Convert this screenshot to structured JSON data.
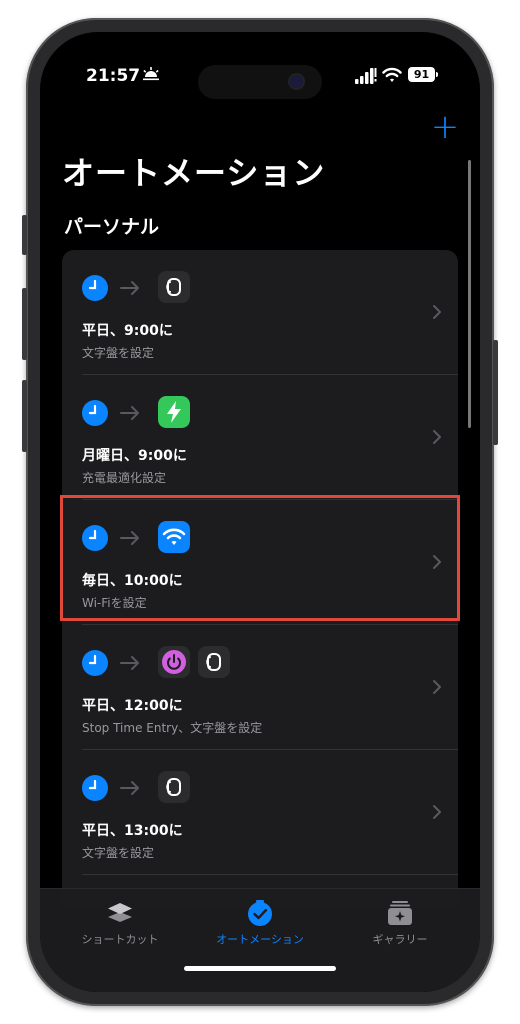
{
  "status_bar": {
    "time": "21:57",
    "battery": "91"
  },
  "header": {
    "title": "オートメーション",
    "add_label": "+"
  },
  "section": {
    "title": "パーソナル"
  },
  "automations": [
    {
      "title": "平日、9:00に",
      "subtitle": "文字盤を設定",
      "actions": [
        "watch-face-icon"
      ]
    },
    {
      "title": "月曜日、9:00に",
      "subtitle": "充電最適化設定",
      "actions": [
        "bolt-icon"
      ]
    },
    {
      "title": "毎日、10:00に",
      "subtitle": "Wi-Fiを設定",
      "actions": [
        "wifi-icon"
      ],
      "highlighted": true
    },
    {
      "title": "平日、12:00に",
      "subtitle": "Stop Time Entry、文字盤を設定",
      "actions": [
        "power-icon",
        "watch-face-icon"
      ]
    },
    {
      "title": "平日、13:00に",
      "subtitle": "文字盤を設定",
      "actions": [
        "watch-face-icon"
      ]
    }
  ],
  "tab_bar": {
    "tabs": [
      {
        "label": "ショートカット",
        "icon": "layers-icon",
        "active": false
      },
      {
        "label": "オートメーション",
        "icon": "clock-check-icon",
        "active": true
      },
      {
        "label": "ギャラリー",
        "icon": "gallery-icon",
        "active": false
      }
    ]
  },
  "colors": {
    "accent": "#0a84ff",
    "highlight": "#e0483a",
    "green": "#34c759",
    "purple": "#d060e0"
  }
}
